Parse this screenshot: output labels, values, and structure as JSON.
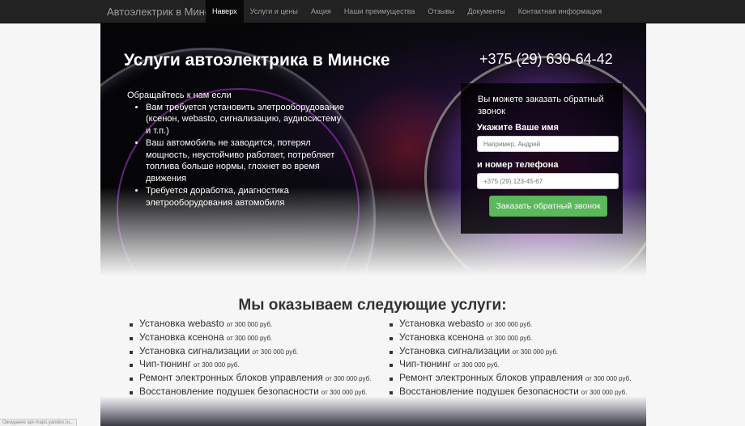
{
  "navbar": {
    "brand": "Автоэлектрик в Минске",
    "items": [
      {
        "label": "Наверх",
        "active": true
      },
      {
        "label": "Услуги и цены",
        "active": false
      },
      {
        "label": "Акция",
        "active": false
      },
      {
        "label": "Наши преимущества",
        "active": false
      },
      {
        "label": "Отзывы",
        "active": false
      },
      {
        "label": "Документы",
        "active": false
      },
      {
        "label": "Контактная информация",
        "active": false
      }
    ]
  },
  "hero": {
    "title": "Услуги автоэлектрика в Минске",
    "phone": "+375 (29) 630-64-42",
    "intro": "Обращайтесь к нам если",
    "reasons": [
      "Вам требуется установить элетрооборудование (ксенон, webasto, сигнализацию, аудиосистему и т.п.)",
      "Ваш автомобиль не заводится, потерял мощность, неустойчиво работает, потребляет топлива больше нормы, глохнет во время движения",
      "Требуется доработка, диагностика элетрооборудования автомобиля"
    ]
  },
  "callback": {
    "intro": "Вы можете заказать обратный звонок",
    "name_label": "Укажите Ваше имя",
    "name_placeholder": "Например, Андрей",
    "phone_label": "и номер телефона",
    "phone_placeholder": "+375 (29) 123-45-67",
    "button": "Заказать обратный звонок"
  },
  "services": {
    "title": "Мы оказываем следующие услуги:",
    "left": [
      {
        "name": "Установка webasto",
        "price": "от 300 000 руб."
      },
      {
        "name": "Установка ксенона",
        "price": "от 300 000 руб."
      },
      {
        "name": "Установка сигнализации",
        "price": "от 300 000 руб."
      },
      {
        "name": "Чип-тюнинг",
        "price": "от 300 000 руб."
      },
      {
        "name": "Ремонт электронных блоков управления",
        "price": "от 300 000 руб."
      },
      {
        "name": "Восстановление подушек безопасности",
        "price": "от 300 000 руб."
      }
    ],
    "right": [
      {
        "name": "Установка webasto",
        "price": "от 300 000 руб."
      },
      {
        "name": "Установка ксенона",
        "price": "от 300 000 руб."
      },
      {
        "name": "Установка сигнализации",
        "price": "от 300 000 руб."
      },
      {
        "name": "Чип-тюнинг",
        "price": "от 300 000 руб."
      },
      {
        "name": "Ремонт электронных блоков управления",
        "price": "от 300 000 руб."
      },
      {
        "name": "Восстановление подушек безопасности",
        "price": "от 300 000 руб."
      }
    ]
  },
  "status_bar": "Ожидание api-maps.yandex.ru..."
}
